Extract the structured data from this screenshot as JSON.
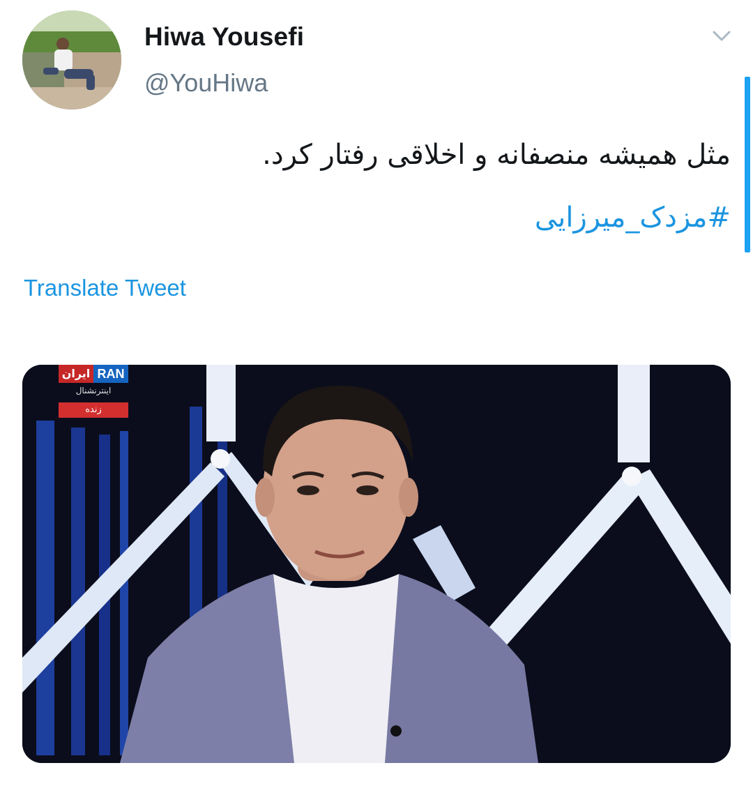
{
  "author": {
    "display_name": "Hiwa Yousefi",
    "handle": "@YouHiwa"
  },
  "tweet": {
    "text": "مثل همیشه منصفانه و اخلاقی رفتار کرد.",
    "hashtag": "#مزدک_میرزایی",
    "translate_label": "Translate Tweet"
  },
  "media": {
    "channel_logo_en": "RAN",
    "channel_logo_fa": "ایران",
    "channel_subtitle": "اینترنشنال",
    "live_label": "زنده"
  },
  "icons": {
    "menu": "chevron-down-icon"
  },
  "colors": {
    "link": "#1b95e0",
    "text": "#14171a",
    "secondary": "#657786",
    "scroll_accent": "#1da1f2"
  }
}
